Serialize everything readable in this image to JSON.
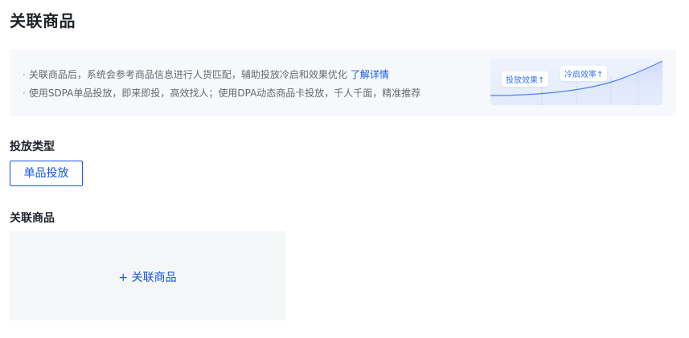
{
  "page": {
    "title": "关联商品"
  },
  "banner": {
    "line1_text": "关联商品后，系统会参考商品信息进行人货匹配，辅助投放冷启和效果优化",
    "line1_link": "了解详情",
    "line2_text": "使用SDPA单品投放，即来即投，高效找人；使用DPA动态商品卡投放，千人千面，精准推荐",
    "bullet": "·",
    "illustration": {
      "pill1": "投放效果↑",
      "pill2": "冷启效率↑"
    }
  },
  "delivery_type": {
    "label": "投放类型",
    "selected_option": "单品投放"
  },
  "linked_products": {
    "label": "关联商品",
    "add_button": "+ 关联商品"
  },
  "colors": {
    "accent": "#1456f0",
    "banner_bg": "#f6f8fb",
    "add_box_bg": "#f5f6f7",
    "text_primary": "#1f2329",
    "text_secondary": "#646a73"
  }
}
